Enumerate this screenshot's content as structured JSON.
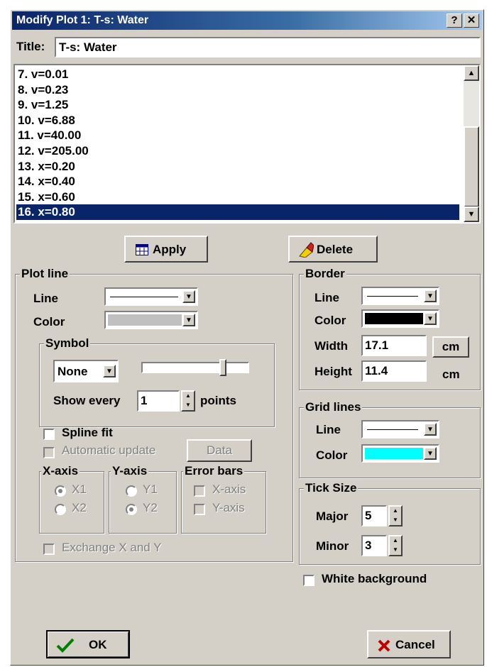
{
  "window": {
    "title": "Modify Plot 1: T-s: Water",
    "help": "?",
    "close": "✕"
  },
  "title_field": {
    "label": "Title:",
    "value": "T-s: Water"
  },
  "plot_list": {
    "items": [
      "7.  v=0.01",
      "8.  v=0.23",
      "9.  v=1.25",
      "10.  v=6.88",
      "11.  v=40.00",
      "12.  v=205.00",
      "13.  x=0.20",
      "14.  x=0.40",
      "15.  x=0.60",
      "16.  x=0.80"
    ],
    "selected": "16.  x=0.80"
  },
  "actions": {
    "apply": "Apply",
    "delete": "Delete",
    "ok": "OK",
    "cancel": "Cancel"
  },
  "plot_line": {
    "group": "Plot line",
    "line_label": "Line",
    "color_label": "Color",
    "color_value": "#c0c0c0",
    "symbol": {
      "group": "Symbol",
      "value": "None",
      "slider_level": 0.78,
      "show_every_label": "Show every",
      "show_every_value": "1",
      "points_label": "points"
    },
    "spline_fit": "Spline fit",
    "automatic_update": "Automatic update",
    "data_button": "Data",
    "x_axis": {
      "group": "X-axis",
      "x1": "X1",
      "x2": "X2"
    },
    "y_axis": {
      "group": "Y-axis",
      "y1": "Y1",
      "y2": "Y2"
    },
    "error_bars": {
      "group": "Error bars",
      "x": "X-axis",
      "y": "Y-axis"
    },
    "exchange": "Exchange X and Y"
  },
  "border": {
    "group": "Border",
    "line_label": "Line",
    "color_label": "Color",
    "color_value": "#000000",
    "width_label": "Width",
    "width_value": "17.1",
    "height_label": "Height",
    "height_value": "11.4",
    "unit": "cm"
  },
  "grid_lines": {
    "group": "Grid lines",
    "line_label": "Line",
    "color_label": "Color",
    "color_value": "#00ffff"
  },
  "tick_size": {
    "group": "Tick Size",
    "major_label": "Major",
    "major_value": "5",
    "minor_label": "Minor",
    "minor_value": "3"
  },
  "white_background": "White background"
}
